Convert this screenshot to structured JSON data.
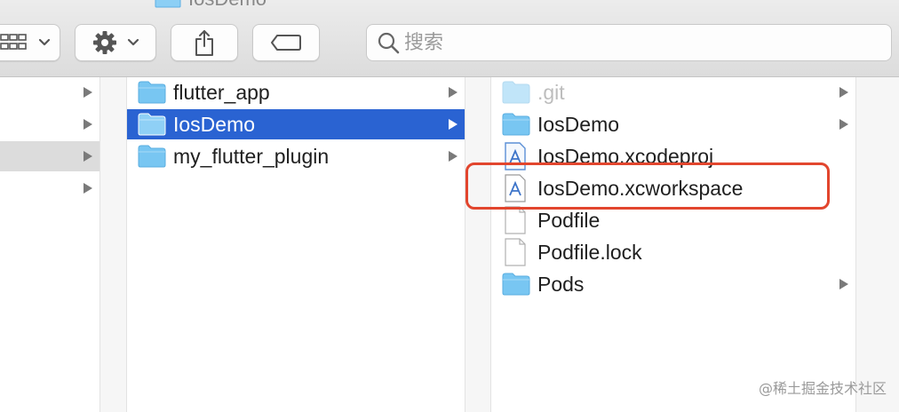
{
  "window": {
    "title": "IosDemo"
  },
  "toolbar": {
    "view_button_icon": "column-view-icon",
    "action_button_icon": "gear-icon",
    "share_button_icon": "share-icon",
    "tags_button_icon": "tag-icon",
    "search_placeholder": "搜索"
  },
  "column1": {
    "disclosure_rows": 4,
    "highlighted_row": 3
  },
  "column2": {
    "items": [
      {
        "label": "flutter_app",
        "kind": "folder",
        "has_children": true
      },
      {
        "label": "IosDemo",
        "kind": "folder",
        "has_children": true,
        "selected": true
      },
      {
        "label": "my_flutter_plugin",
        "kind": "folder",
        "has_children": true
      }
    ]
  },
  "column3": {
    "items": [
      {
        "label": ".git",
        "kind": "folder",
        "has_children": true,
        "dimmed": true
      },
      {
        "label": "IosDemo",
        "kind": "folder",
        "has_children": true
      },
      {
        "label": "IosDemo.xcodeproj",
        "kind": "xcode-project",
        "has_children": false
      },
      {
        "label": "IosDemo.xcworkspace",
        "kind": "xcode-workspace",
        "has_children": false,
        "annotated": true
      },
      {
        "label": "Podfile",
        "kind": "document",
        "has_children": false
      },
      {
        "label": "Podfile.lock",
        "kind": "document",
        "has_children": false
      },
      {
        "label": "Pods",
        "kind": "folder",
        "has_children": true
      }
    ]
  },
  "colors": {
    "selection": "#2a63d2",
    "annotation": "#e2462e",
    "folder": "#6fbfef"
  },
  "watermark": "@稀土掘金技术社区"
}
